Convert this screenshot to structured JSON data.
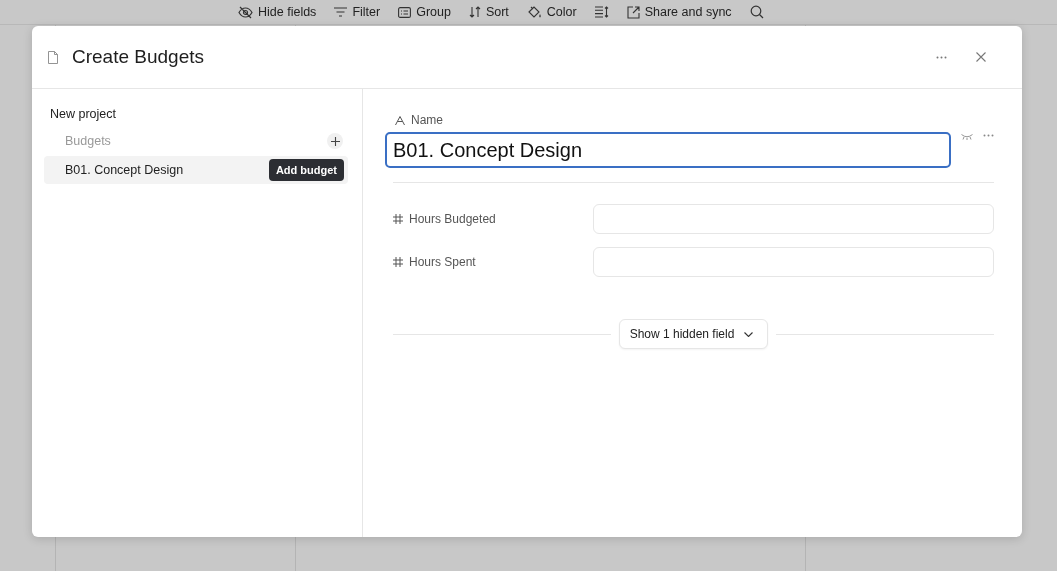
{
  "toolbar": [
    {
      "kind": "hide",
      "label": "Hide fields"
    },
    {
      "kind": "filter",
      "label": "Filter"
    },
    {
      "kind": "group",
      "label": "Group"
    },
    {
      "kind": "sort",
      "label": "Sort"
    },
    {
      "kind": "color",
      "label": "Color"
    },
    {
      "kind": "height"
    },
    {
      "kind": "share",
      "label": "Share and sync"
    },
    {
      "kind": "search"
    }
  ],
  "dialog": {
    "title": "Create Budgets",
    "sidebar": {
      "project": "New project",
      "section": "Budgets",
      "items": [
        {
          "label": "B01. Concept Design",
          "selected": true
        }
      ],
      "tooltip": "Add budget"
    },
    "name_field": {
      "label": "Name",
      "value": "B01. Concept Design",
      "focused": true
    },
    "fields": [
      {
        "kind": "number",
        "label": "Hours Budgeted"
      },
      {
        "kind": "number",
        "label": "Hours Spent"
      }
    ],
    "hidden_button": "Show 1 hidden field"
  }
}
